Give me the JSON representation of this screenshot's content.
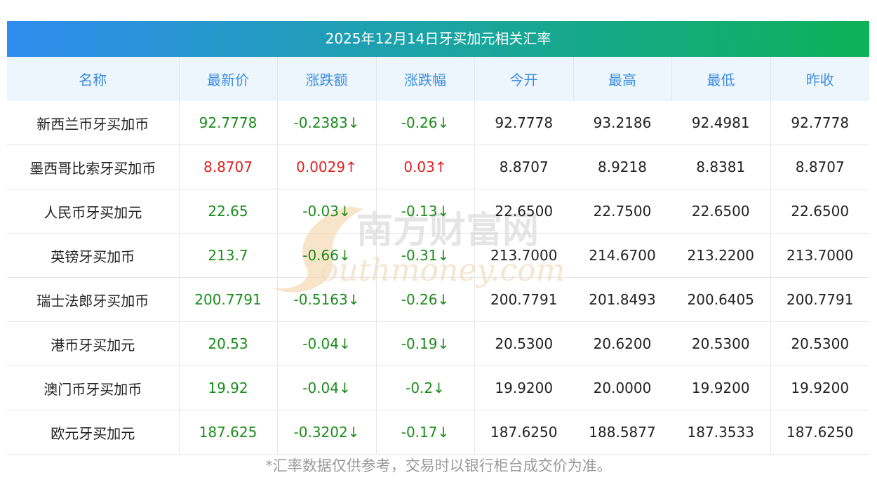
{
  "title": "2025年12月14日牙买加元相关汇率",
  "columns": [
    "名称",
    "最新价",
    "涨跌额",
    "涨跌幅",
    "今开",
    "最高",
    "最低",
    "昨收"
  ],
  "rows": [
    {
      "name": "新西兰币牙买加币",
      "latest": "92.7778",
      "change": "-0.2383↓",
      "pct": "-0.26↓",
      "open": "92.7778",
      "high": "93.2186",
      "low": "92.4981",
      "prev": "92.7778",
      "trend": "down"
    },
    {
      "name": "墨西哥比索牙买加币",
      "latest": "8.8707",
      "change": "0.0029↑",
      "pct": "0.03↑",
      "open": "8.8707",
      "high": "8.9218",
      "low": "8.8381",
      "prev": "8.8707",
      "trend": "up"
    },
    {
      "name": "人民币牙买加元",
      "latest": "22.65",
      "change": "-0.03↓",
      "pct": "-0.13↓",
      "open": "22.6500",
      "high": "22.7500",
      "low": "22.6500",
      "prev": "22.6500",
      "trend": "down"
    },
    {
      "name": "英镑牙买加币",
      "latest": "213.7",
      "change": "-0.66↓",
      "pct": "-0.31↓",
      "open": "213.7000",
      "high": "214.6700",
      "low": "213.2200",
      "prev": "213.7000",
      "trend": "down"
    },
    {
      "name": "瑞士法郎牙买加币",
      "latest": "200.7791",
      "change": "-0.5163↓",
      "pct": "-0.26↓",
      "open": "200.7791",
      "high": "201.8493",
      "low": "200.6405",
      "prev": "200.7791",
      "trend": "down"
    },
    {
      "name": "港币牙买加元",
      "latest": "20.53",
      "change": "-0.04↓",
      "pct": "-0.19↓",
      "open": "20.5300",
      "high": "20.6200",
      "low": "20.5300",
      "prev": "20.5300",
      "trend": "down"
    },
    {
      "name": "澳门币牙买加币",
      "latest": "19.92",
      "change": "-0.04↓",
      "pct": "-0.2↓",
      "open": "19.9200",
      "high": "20.0000",
      "low": "19.9200",
      "prev": "19.9200",
      "trend": "down"
    },
    {
      "name": "欧元牙买加元",
      "latest": "187.625",
      "change": "-0.3202↓",
      "pct": "-0.17↓",
      "open": "187.6250",
      "high": "188.5877",
      "low": "187.3533",
      "prev": "187.6250",
      "trend": "down"
    }
  ],
  "watermark": {
    "cn": "南方财富网",
    "en": "outhmoney.com"
  },
  "footnote": "*汇率数据仅供参考，交易时以银行柜台成交价为准。",
  "colors": {
    "up": "#e02020",
    "down": "#1a8c1a",
    "header_text": "#3c8ede"
  }
}
